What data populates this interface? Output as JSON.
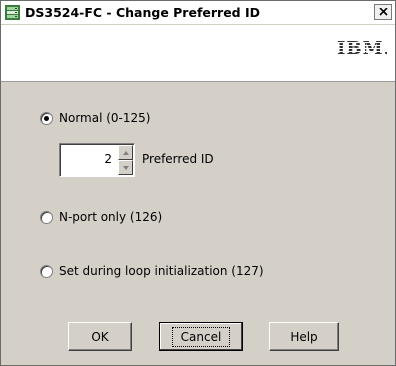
{
  "window": {
    "title": "DS3524-FC - Change Preferred ID",
    "brand": "IBM."
  },
  "options": {
    "normal_label": "Normal (0-125)",
    "nport_label": "N-port only (126)",
    "loop_label": "Set during loop initialization (127)",
    "selected": "normal"
  },
  "preferred_id": {
    "value": "2",
    "label": "Preferred ID"
  },
  "buttons": {
    "ok": "OK",
    "cancel": "Cancel",
    "help": "Help"
  }
}
